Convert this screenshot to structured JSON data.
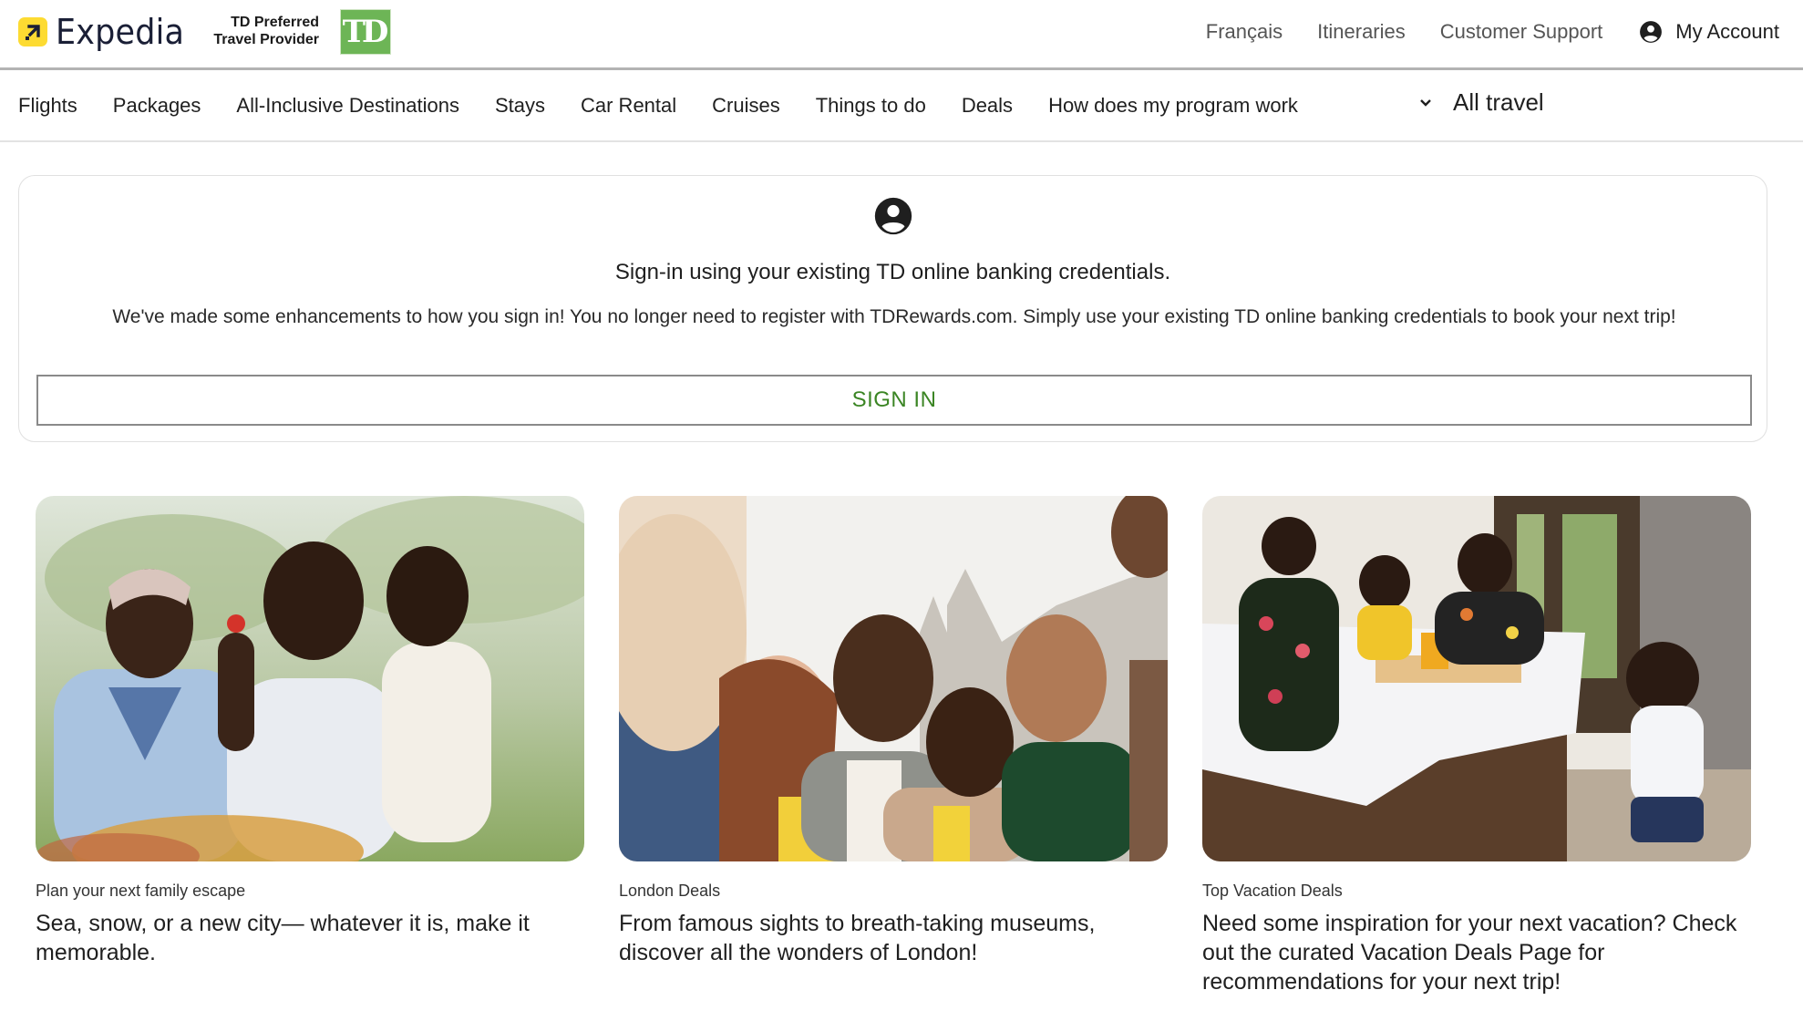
{
  "header": {
    "brand": "Expedia",
    "partner_line1": "TD Preferred",
    "partner_line2": "Travel Provider",
    "partner_logo_text": "TD",
    "links": [
      "Français",
      "Itineraries",
      "Customer Support"
    ],
    "account_label": "My Account",
    "account_icon": "account-circle-icon"
  },
  "nav": {
    "items": [
      "Flights",
      "Packages",
      "All-Inclusive Destinations",
      "Stays",
      "Car Rental",
      "Cruises",
      "Things to do",
      "Deals",
      "How does my program work"
    ],
    "dropdown_label": "All travel",
    "dropdown_icon": "chevron-down-icon"
  },
  "signin_card": {
    "icon": "account-circle-icon",
    "title": "Sign-in using your existing TD online banking credentials.",
    "body": "We've made some enhancements to how you sign in! You no longer need to register with TDRewards.com. Simply use your existing TD online banking credentials to book your next trip!",
    "button_label": "SIGN IN"
  },
  "promos": [
    {
      "label": "Plan your next family escape",
      "headline": "Sea, snow, or a new city— whatever it is, make it memorable.",
      "image_alt": "Family smiling outdoors in a garden, father holding daughter with a flower"
    },
    {
      "label": "London Deals",
      "headline": "From famous sights to breath-taking museums, discover all the wonders of London!",
      "image_alt": "Group of friends laughing together in front of historic buildings"
    },
    {
      "label": "Top Vacation Deals",
      "headline": "Need some inspiration for your next vacation? Check out the curated Vacation Deals Page for recommendations for your next trip!",
      "image_alt": "Family having breakfast on a bed in a resort room"
    }
  ],
  "colors": {
    "brand_yellow": "#fddb32",
    "brand_navy": "#1a1f36",
    "td_green": "#6db556",
    "signin_green": "#3b8524"
  }
}
